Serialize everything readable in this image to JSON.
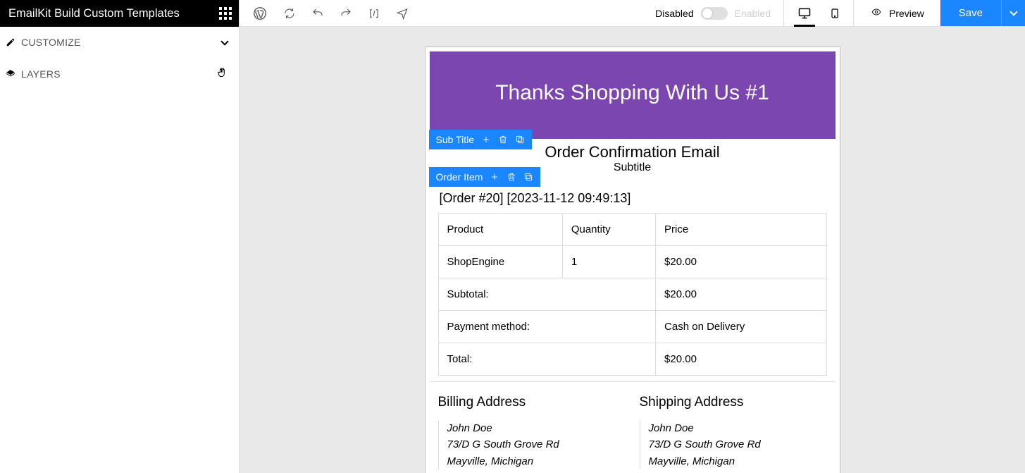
{
  "sidebar": {
    "brand": "EmailKit Build Custom Templates",
    "panels": [
      {
        "id": "customize",
        "label": "CUSTOMIZE",
        "icon": "pencil-icon"
      },
      {
        "id": "layers",
        "label": "LAYERS",
        "icon": "layers-icon"
      }
    ]
  },
  "topbar": {
    "toggle": {
      "left_label": "Disabled",
      "right_label": "Enabled",
      "on": false
    },
    "preview_label": "Preview",
    "save_label": "Save"
  },
  "email": {
    "hero_title": "Thanks Shopping With Us #1",
    "handles": {
      "subtitle": "Sub Title",
      "order_item": "Order Item"
    },
    "section_title": "Order Confirmation Email",
    "section_subtitle": "Subtitle",
    "order_meta": "[Order #20] [2023-11-12 09:49:13]",
    "table": {
      "headers": {
        "product": "Product",
        "quantity": "Quantity",
        "price": "Price"
      },
      "items": [
        {
          "product": "ShopEngine",
          "quantity": "1",
          "price": "$20.00"
        }
      ],
      "summary": [
        {
          "label": "Subtotal:",
          "value": "$20.00",
          "bold": true
        },
        {
          "label": "Payment method:",
          "value": "Cash on Delivery",
          "bold": false
        },
        {
          "label": "Total:",
          "value": "$20.00",
          "bold": false
        }
      ]
    },
    "addresses": {
      "billing": {
        "title": "Billing Address",
        "lines": [
          "John Doe",
          "73/D G South Grove Rd",
          "Mayville, Michigan"
        ]
      },
      "shipping": {
        "title": "Shipping Address",
        "lines": [
          "John Doe",
          "73/D G South Grove Rd",
          "Mayville, Michigan"
        ]
      }
    }
  }
}
